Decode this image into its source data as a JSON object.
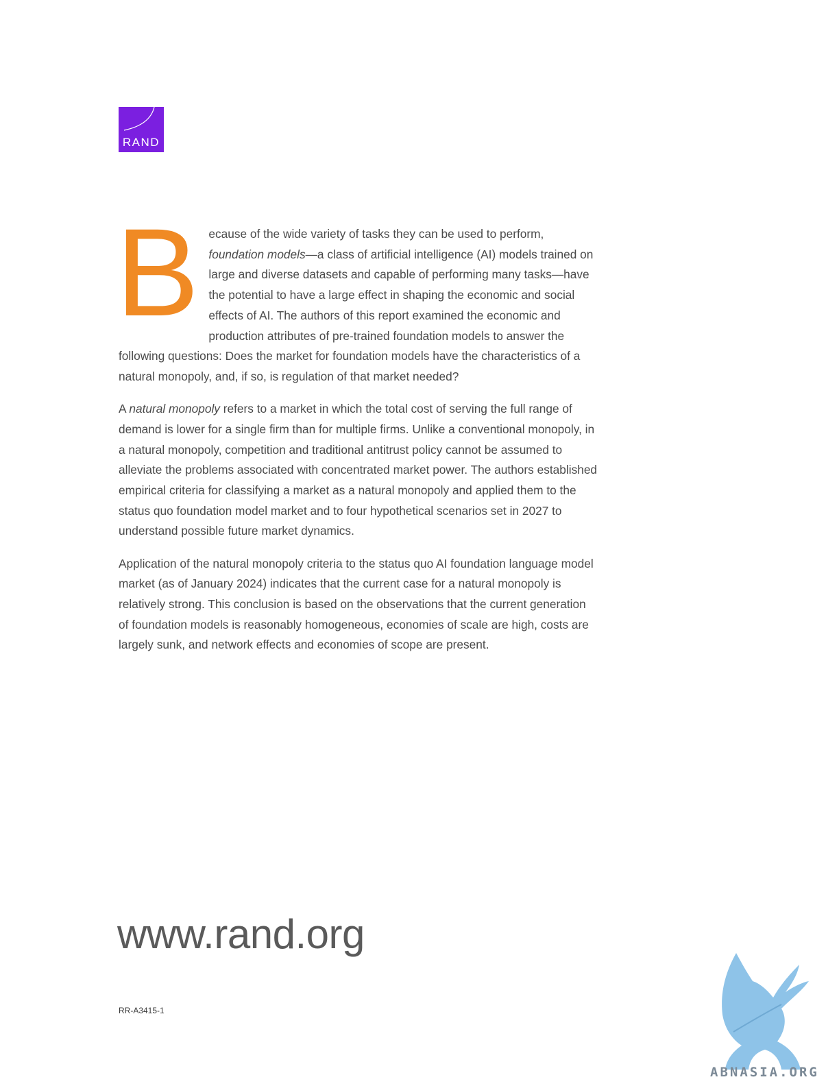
{
  "logo": {
    "label": "RAND",
    "color": "#7b1fe0"
  },
  "drop_cap": {
    "letter": "B",
    "color": "#f08a24"
  },
  "paragraphs": {
    "p1": {
      "after_dropcap": "ecause of the wide variety of tasks they can be used to perform, ",
      "term": "foundation models",
      "rest": "—a class of artificial intelligence (AI) models trained on large and diverse datasets and capable of performing many tasks—have the potential to have a large effect in shaping the economic and social effects of AI. The authors of this report examined the economic and production attributes of pre-trained foundation models to answer the following questions: Does the market for foundation models have the characteristics of a natural monopoly, and, if so, is regulation of that market needed?"
    },
    "p2": {
      "lead": "A ",
      "term": "natural monopoly",
      "rest": " refers to a market in which the total cost of serving the full range of demand is lower for a single firm than for multiple firms. Unlike a conventional monopoly, in a natural monopoly, competition and traditional antitrust policy cannot be assumed to alleviate the problems associated with concentrated market power. The authors established empirical criteria for classifying a market as a natural monopoly and applied them to the status quo foundation model market and to four hypothetical scenarios set in 2027 to understand possible future market dynamics."
    },
    "p3": {
      "text": "Application of the natural monopoly criteria to the status quo AI foundation language model market (as of January 2024) indicates that the current case for a natural monopoly is relatively strong. This conclusion is based on the observations that the current generation of foundation models is reasonably homogeneous, economies of scale are high, costs are largely sunk, and network effects and economies of scope are present."
    }
  },
  "website": "www.rand.org",
  "report_id": "RR-A3415-1",
  "watermark": {
    "text": "ABNASIA.ORG",
    "icon": "griffin-icon",
    "color": "#8ec3e8"
  }
}
